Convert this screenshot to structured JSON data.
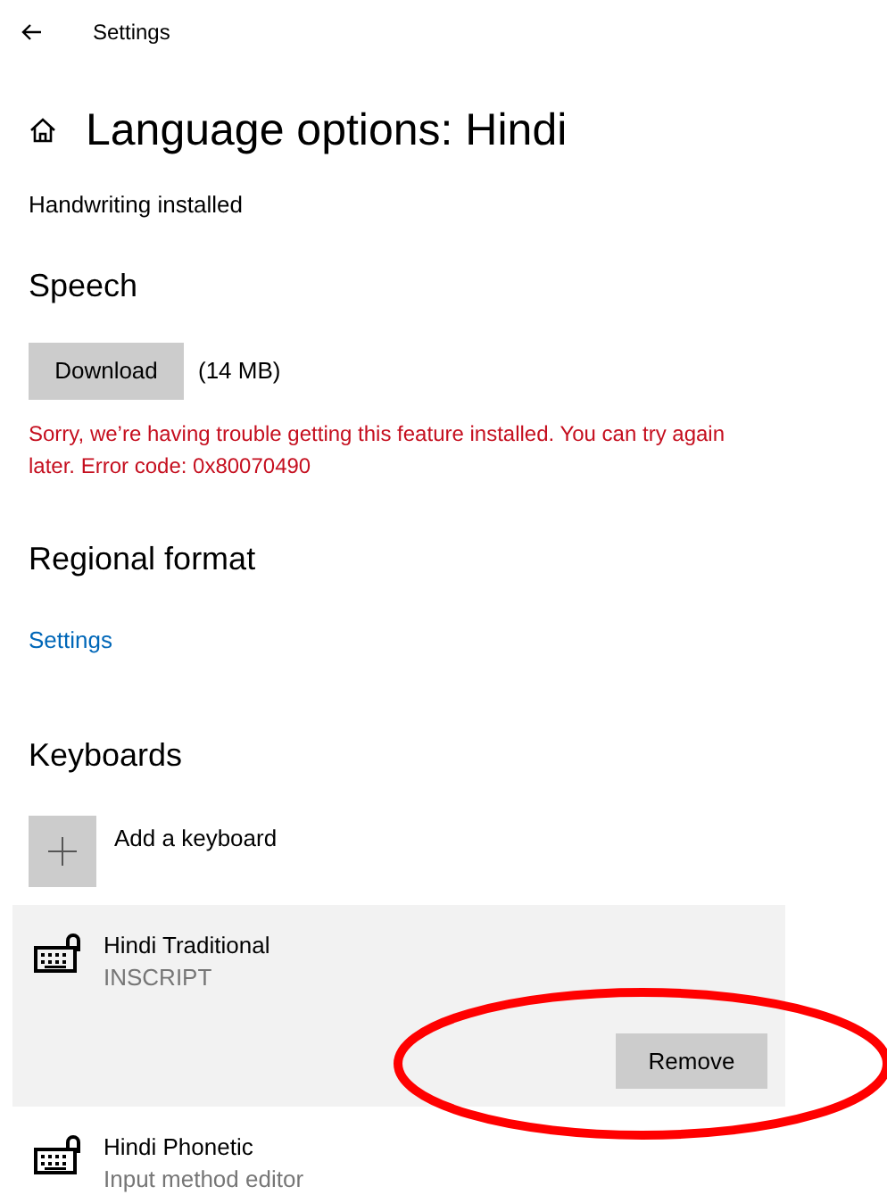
{
  "header": {
    "title": "Settings"
  },
  "page_title": "Language options: Hindi",
  "handwriting_status": "Handwriting installed",
  "speech": {
    "heading": "Speech",
    "button": "Download",
    "size": "(14 MB)",
    "error": "Sorry, we’re having trouble getting this feature installed. You can try again later. Error code: 0x80070490"
  },
  "regional_format": {
    "heading": "Regional format",
    "link": "Settings"
  },
  "keyboards": {
    "heading": "Keyboards",
    "add_label": "Add a keyboard",
    "items": [
      {
        "name": "Hindi Traditional",
        "subtitle": "INSCRIPT",
        "selected": true,
        "action": "Remove"
      },
      {
        "name": "Hindi Phonetic",
        "subtitle": "Input method editor",
        "selected": false
      }
    ]
  }
}
